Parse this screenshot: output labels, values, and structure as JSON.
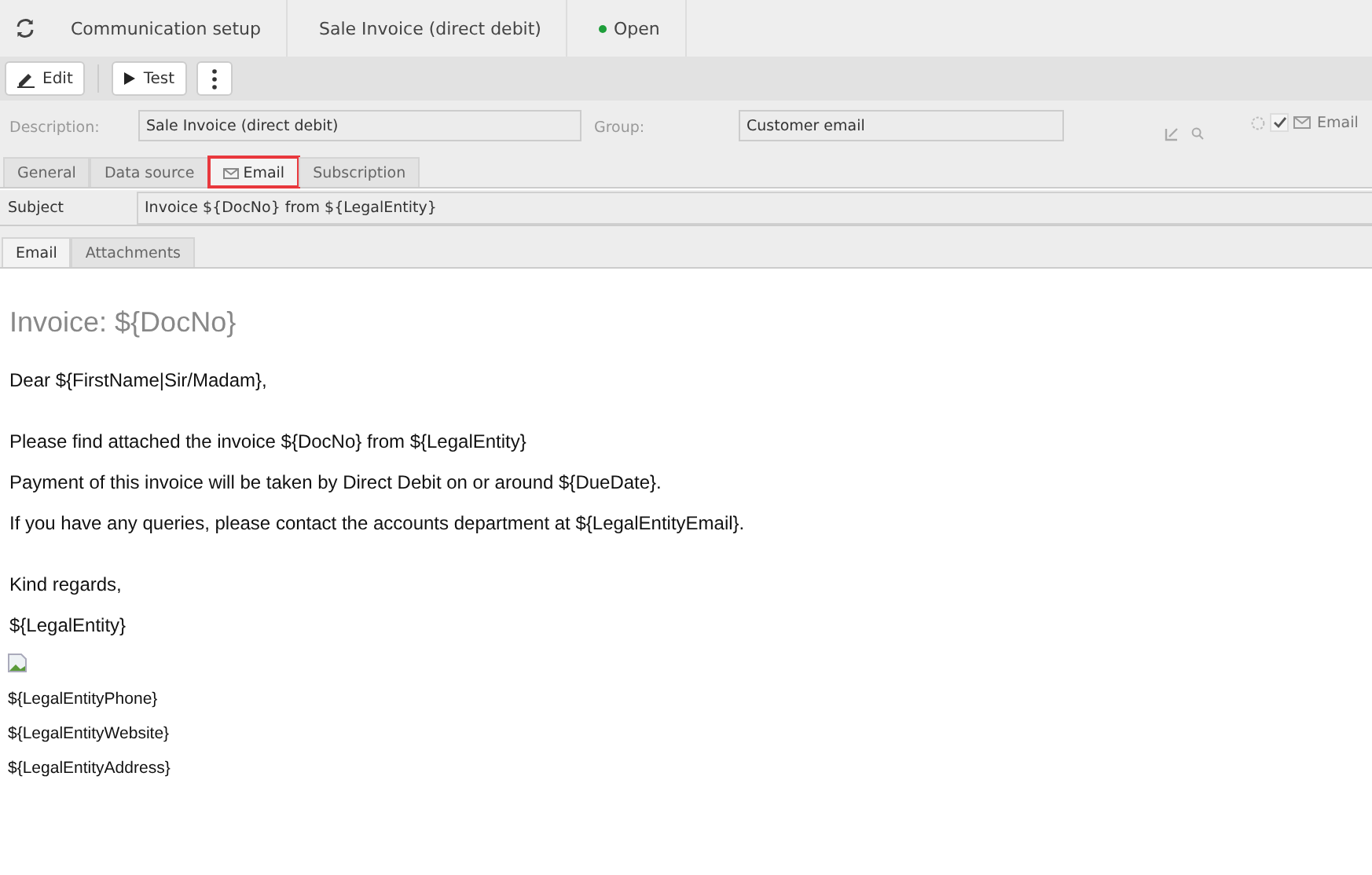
{
  "breadcrumbs": [
    {
      "label": "Communication setup"
    },
    {
      "label": "Sale Invoice (direct debit)"
    }
  ],
  "status": {
    "label": "Open",
    "color": "#1e9e3a"
  },
  "toolbar": [
    {
      "kind": "edit",
      "label": "Edit"
    },
    {
      "kind": "test",
      "label": "Test"
    },
    {
      "kind": "more"
    }
  ],
  "fields": {
    "description_label": "Description:",
    "description": "Sale Invoice (direct debit)",
    "group_label": "Group:",
    "group": "Customer email",
    "email_option": {
      "label": "Email",
      "checked": true
    }
  },
  "tabs": [
    {
      "label": "General",
      "selected": false
    },
    {
      "label": "Data source",
      "selected": false
    },
    {
      "label": "Email",
      "selected": true,
      "icon": true,
      "highlighted": true
    },
    {
      "label": "Subscription",
      "selected": false
    }
  ],
  "subject": {
    "label": "Subject",
    "value": "Invoice ${DocNo} from ${LegalEntity}"
  },
  "inner_tabs": [
    {
      "label": "Email",
      "selected": true
    },
    {
      "label": "Attachments",
      "selected": false
    }
  ],
  "body": [
    {
      "kind": "heading",
      "text": "Invoice: ${DocNo}"
    },
    {
      "kind": "line",
      "text": "Dear ${FirstName|Sir/Madam},"
    },
    {
      "kind": "line",
      "text": "Please find attached the invoice ${DocNo} from ${LegalEntity}",
      "space_before": true
    },
    {
      "kind": "line",
      "text": "Payment of this invoice will be taken by Direct Debit on or around ${DueDate}."
    },
    {
      "kind": "line",
      "text": "If you have any queries, please contact the accounts department at ${LegalEntityEmail}."
    },
    {
      "kind": "line",
      "text": "Kind regards,",
      "space_before": true
    },
    {
      "kind": "line",
      "text": "${LegalEntity}"
    },
    {
      "kind": "image"
    },
    {
      "kind": "small",
      "text": "${LegalEntityPhone}"
    },
    {
      "kind": "small",
      "text": "${LegalEntityWebsite}"
    },
    {
      "kind": "small",
      "text": "${LegalEntityAddress}"
    }
  ]
}
